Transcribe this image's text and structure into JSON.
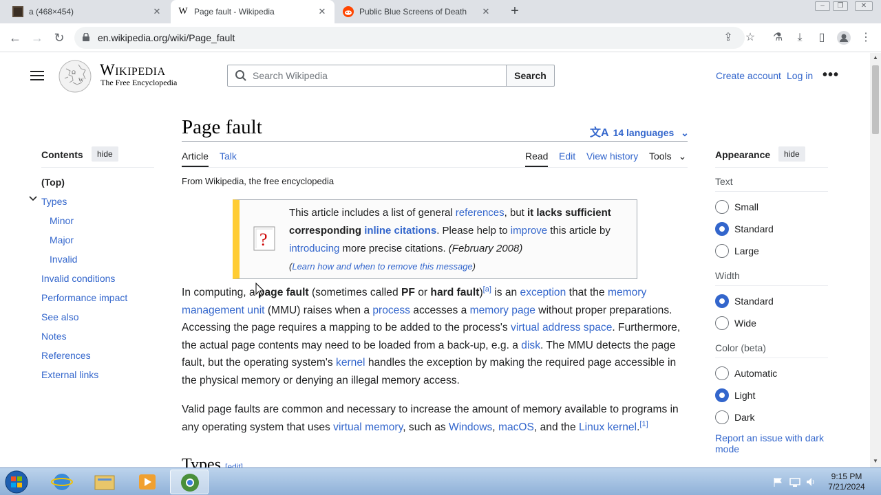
{
  "browser": {
    "tabs": [
      {
        "title": "a (468×454)",
        "active": false
      },
      {
        "title": "Page fault - Wikipedia",
        "active": true
      },
      {
        "title": "Public Blue Screens of Death",
        "active": false
      }
    ],
    "new_tab": "+",
    "url": "en.wikipedia.org/wiki/Page_fault"
  },
  "wiki": {
    "wordmark": "Wikipedia",
    "tagline": "The Free Encyclopedia",
    "search_placeholder": "Search Wikipedia",
    "search_button": "Search",
    "create_account": "Create account",
    "log_in": "Log in",
    "more": "•••",
    "title": "Page fault",
    "languages": "14 languages",
    "tabs": {
      "article": "Article",
      "talk": "Talk",
      "read": "Read",
      "edit": "Edit",
      "history": "View history",
      "tools": "Tools"
    },
    "from": "From Wikipedia, the free encyclopedia",
    "ambox": {
      "t1": "This article includes a list of general ",
      "l1": "references",
      "t2": ", but ",
      "b1": "it lacks sufficient corresponding ",
      "bl1": "inline citations",
      "t3": ". Please help to ",
      "l2": "improve",
      "t4": " this article by ",
      "l3": "introducing",
      "t5": " more precise citations. ",
      "date": "(February 2008)",
      "remove_pre": "(",
      "remove": "Learn how and when to remove this message",
      "remove_post": ")"
    },
    "para1": {
      "a": "In computing, a ",
      "b": "page fault",
      "c": " (sometimes called ",
      "d": "PF",
      "e": " or ",
      "f": "hard fault",
      "g": ")",
      "note": "[a]",
      "h": " is an ",
      "l_exception": "exception",
      "i": " that the ",
      "l_mmu": "memory management unit",
      "j": " (MMU) raises when a ",
      "l_process": "process",
      "k": " accesses a ",
      "l_mempage": "memory page",
      "l": " without proper preparations. Accessing the page requires a mapping to be added to the process's ",
      "l_vas": "virtual address space",
      "m": ". Furthermore, the actual page contents may need to be loaded from a back-up, e.g. a ",
      "l_disk": "disk",
      "n": ". The MMU detects the page fault, but the operating system's ",
      "l_kernel": "kernel",
      "o": " handles the exception by making the required page accessible in the physical memory or denying an illegal memory access."
    },
    "para2": {
      "a": "Valid page faults are common and necessary to increase the amount of memory available to programs in any operating system that uses ",
      "l_vm": "virtual memory",
      "b": ", such as ",
      "l_win": "Windows",
      "c": ", ",
      "l_mac": "macOS",
      "d": ", and the ",
      "l_linux": "Linux kernel",
      "e": ".",
      "ref": "[1]"
    },
    "h2": "Types",
    "h2_edit": "[edit]",
    "toc": {
      "heading": "Contents",
      "hide": "hide",
      "items": [
        "(Top)",
        "Types",
        "Minor",
        "Major",
        "Invalid",
        "Invalid conditions",
        "Performance impact",
        "See also",
        "Notes",
        "References",
        "External links"
      ]
    },
    "appearance": {
      "heading": "Appearance",
      "hide": "hide",
      "text_label": "Text",
      "text_options": [
        "Small",
        "Standard",
        "Large"
      ],
      "text_selected": "Standard",
      "width_label": "Width",
      "width_options": [
        "Standard",
        "Wide"
      ],
      "width_selected": "Standard",
      "color_label": "Color (beta)",
      "color_options": [
        "Automatic",
        "Light",
        "Dark"
      ],
      "color_selected": "Light",
      "report": "Report an issue with dark mode"
    }
  },
  "taskbar": {
    "time": "9:15 PM",
    "date": "7/21/2024"
  }
}
